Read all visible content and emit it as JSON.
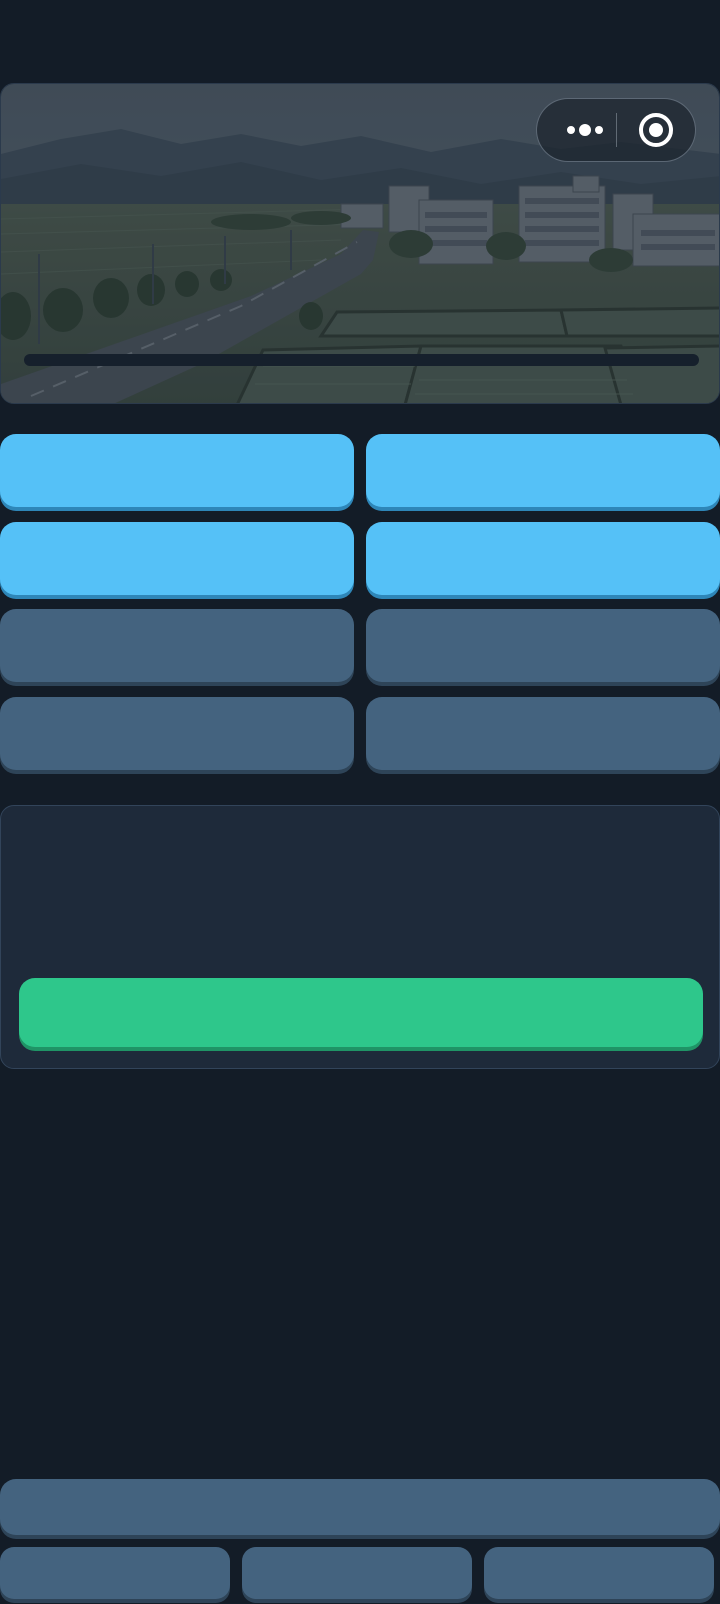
{
  "scene": {
    "image": "countryside-town-illustration",
    "progress": 0
  },
  "capsule": {
    "more_icon": "more-dots-icon",
    "close_icon": "target-circle-icon"
  },
  "options": [
    {
      "label": "",
      "color": "#55c1f7"
    },
    {
      "label": "",
      "color": "#55c1f7"
    },
    {
      "label": "",
      "color": "#55c1f7"
    },
    {
      "label": "",
      "color": "#55c1f7"
    },
    {
      "label": "",
      "color": "#44637f"
    },
    {
      "label": "",
      "color": "#44637f"
    },
    {
      "label": "",
      "color": "#44637f"
    },
    {
      "label": "",
      "color": "#44637f"
    }
  ],
  "panel": {
    "text": "",
    "confirm_label": "",
    "confirm_color": "#2ec78b"
  },
  "bottom_bar": {
    "wide_label": "",
    "tabs": [
      "",
      "",
      ""
    ]
  },
  "colors": {
    "background": "#131c27",
    "panel": "#1e2a3a",
    "accent_blue": "#55c1f7",
    "slate": "#44637f",
    "green": "#2ec78b"
  }
}
